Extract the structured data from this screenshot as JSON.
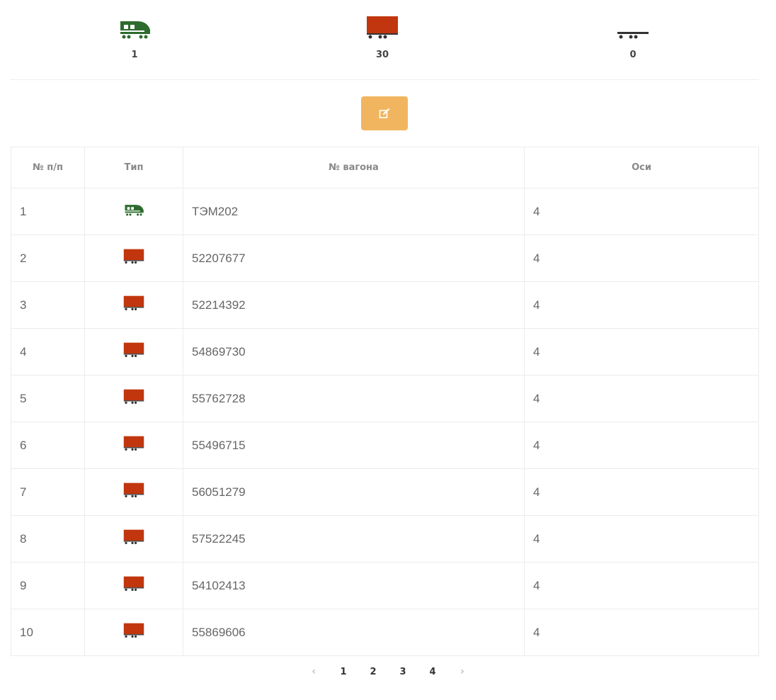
{
  "summary": {
    "locomotive_count": "1",
    "wagon_count": "30",
    "platform_count": "0",
    "icons": [
      "locomotive-icon",
      "wagon-icon",
      "platform-icon"
    ],
    "colors": {
      "locomotive": "#2e6b2e",
      "wagon": "#c1360e",
      "platform": "#333333"
    }
  },
  "toolbar": {
    "edit_icon": "edit-icon",
    "edit_color": "#f0ad4e"
  },
  "table": {
    "columns": [
      "№ п/п",
      "Тип",
      "№ вагона",
      "Оси"
    ],
    "rows": [
      {
        "n": "1",
        "type": "locomotive",
        "number": "ТЭМ202",
        "axles": "4"
      },
      {
        "n": "2",
        "type": "wagon",
        "number": "52207677",
        "axles": "4"
      },
      {
        "n": "3",
        "type": "wagon",
        "number": "52214392",
        "axles": "4"
      },
      {
        "n": "4",
        "type": "wagon",
        "number": "54869730",
        "axles": "4"
      },
      {
        "n": "5",
        "type": "wagon",
        "number": "55762728",
        "axles": "4"
      },
      {
        "n": "6",
        "type": "wagon",
        "number": "55496715",
        "axles": "4"
      },
      {
        "n": "7",
        "type": "wagon",
        "number": "56051279",
        "axles": "4"
      },
      {
        "n": "8",
        "type": "wagon",
        "number": "57522245",
        "axles": "4"
      },
      {
        "n": "9",
        "type": "wagon",
        "number": "54102413",
        "axles": "4"
      },
      {
        "n": "10",
        "type": "wagon",
        "number": "55869606",
        "axles": "4"
      }
    ]
  },
  "pagination": {
    "prev": "‹",
    "pages": [
      "1",
      "2",
      "3",
      "4"
    ],
    "next": "›"
  }
}
